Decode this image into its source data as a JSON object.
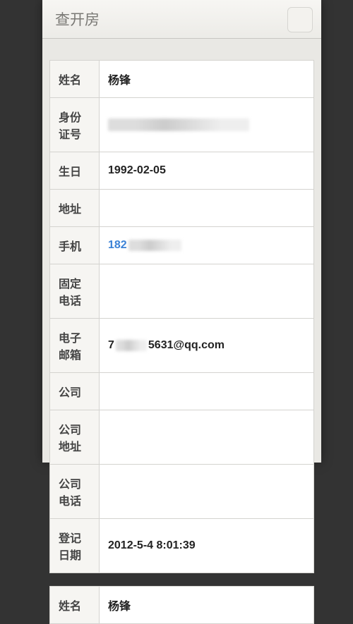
{
  "header": {
    "title": "查开房"
  },
  "fields": [
    {
      "label": "姓名",
      "value": "杨锋",
      "type": "text"
    },
    {
      "label": "身份证号",
      "value": "",
      "type": "censored-id"
    },
    {
      "label": "生日",
      "value": "1992-02-05",
      "type": "text"
    },
    {
      "label": "地址",
      "value": "",
      "type": "text"
    },
    {
      "label": "手机",
      "value_prefix": "182",
      "type": "phone-censored"
    },
    {
      "label": "固定电话",
      "value": "",
      "type": "text"
    },
    {
      "label": "电子邮箱",
      "value_prefix": "7",
      "value_suffix": "5631@qq.com",
      "type": "email-censored"
    },
    {
      "label": "公司",
      "value": "",
      "type": "text"
    },
    {
      "label": "公司地址",
      "value": "",
      "type": "text"
    },
    {
      "label": "公司电话",
      "value": "",
      "type": "text"
    },
    {
      "label": "登记日期",
      "value": "2012-5-4 8:01:39",
      "type": "text"
    }
  ],
  "next_record": {
    "name_label": "姓名",
    "name_value": "杨锋"
  }
}
